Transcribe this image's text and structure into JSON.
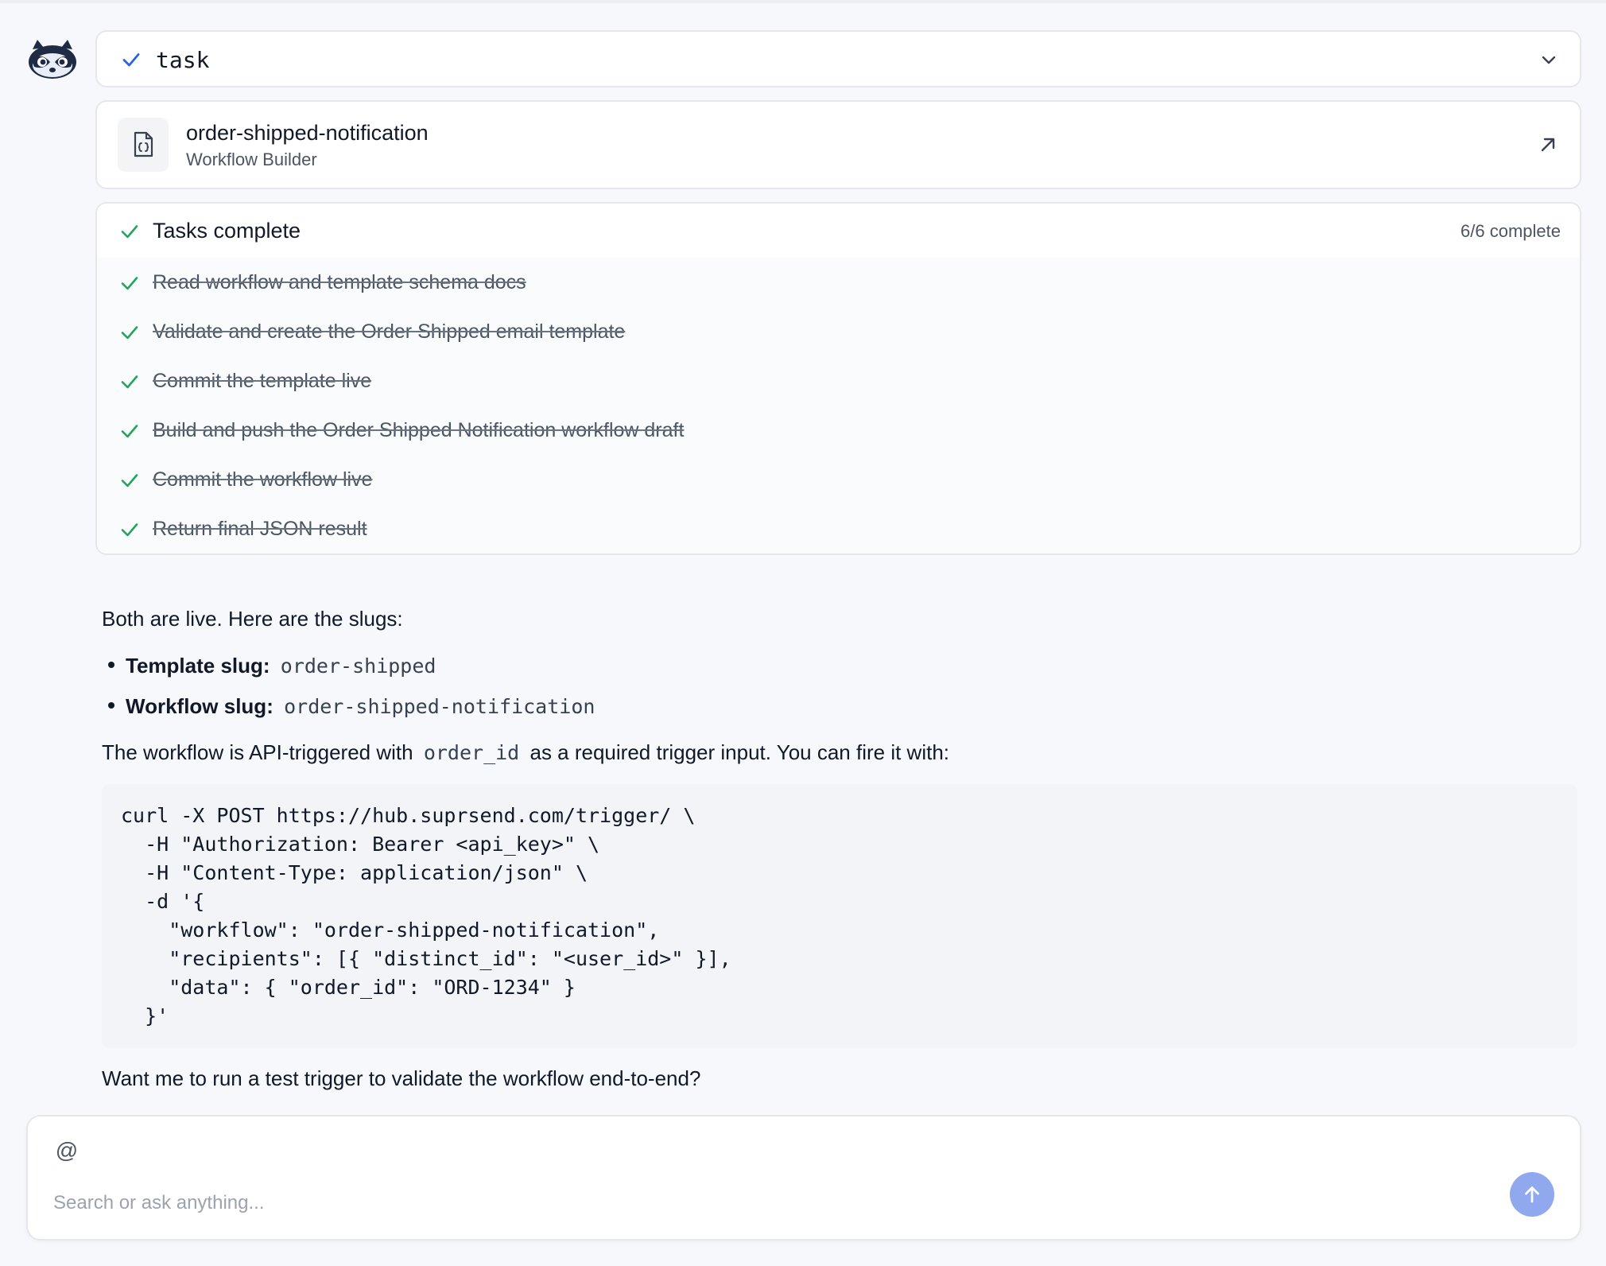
{
  "task_header": {
    "label": "task",
    "status_icon": "check-icon",
    "toggle_icon": "chevron-down-icon"
  },
  "workflow_card": {
    "title": "order-shipped-notification",
    "subtitle": "Workflow Builder",
    "icon": "code-file-icon",
    "open_icon": "external-link-icon"
  },
  "tasks": {
    "title": "Tasks complete",
    "count_label": "6/6 complete",
    "items": [
      {
        "label": "Read workflow and template schema docs"
      },
      {
        "label": "Validate and create the Order Shipped email template"
      },
      {
        "label": "Commit the template live"
      },
      {
        "label": "Build and push the Order Shipped Notification workflow draft"
      },
      {
        "label": "Commit the workflow live"
      },
      {
        "label": "Return final JSON result"
      }
    ]
  },
  "message": {
    "intro": "Both are live. Here are the slugs:",
    "bullets": [
      {
        "label": "Template slug:",
        "value": "order-shipped"
      },
      {
        "label": "Workflow slug:",
        "value": "order-shipped-notification"
      }
    ],
    "trigger_text_before": "The workflow is API-triggered with",
    "trigger_param": "order_id",
    "trigger_text_after": "as a required trigger input. You can fire it with:",
    "code": "curl -X POST https://hub.suprsend.com/trigger/ \\\n  -H \"Authorization: Bearer <api_key>\" \\\n  -H \"Content-Type: application/json\" \\\n  -d '{\n    \"workflow\": \"order-shipped-notification\",\n    \"recipients\": [{ \"distinct_id\": \"<user_id>\" }],\n    \"data\": { \"order_id\": \"ORD-1234\" }\n  }'",
    "closing": "Want me to run a test trigger to validate the workflow end-to-end?"
  },
  "composer": {
    "mention_symbol": "@",
    "placeholder": "Search or ask anything...",
    "value": "",
    "send_icon": "arrow-up-icon"
  },
  "colors": {
    "background": "#f7f8fb",
    "check_blue": "#2563eb",
    "check_green": "#22a55b",
    "send_button": "#8fa8ee",
    "border": "#e5e7eb"
  }
}
